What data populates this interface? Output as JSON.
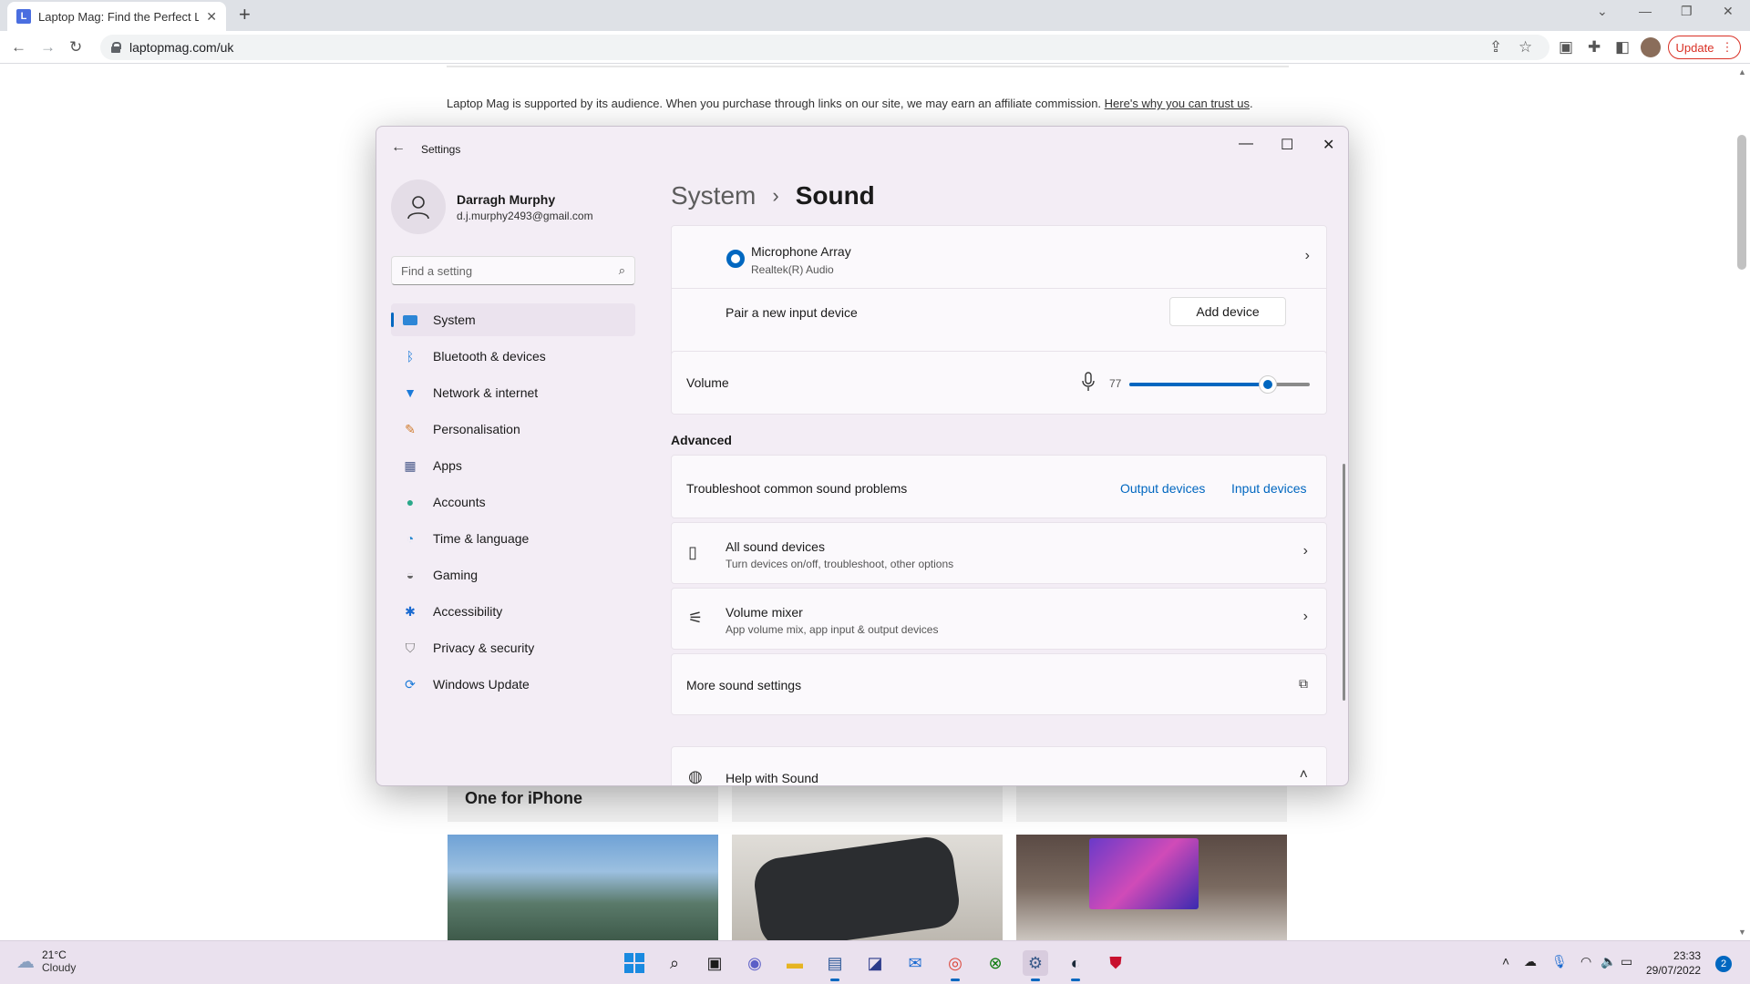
{
  "browser": {
    "tab_title": "Laptop Mag: Find the Perfect Lap",
    "url": "laptopmag.com/uk",
    "update_label": "Update"
  },
  "page": {
    "affiliate_text": "Laptop Mag is supported by its audience. When you purchase through links on our site, we may earn an affiliate commission.",
    "affiliate_link": "Here's why you can trust us",
    "card_title": "One for iPhone"
  },
  "settings": {
    "window_title": "Settings",
    "user": {
      "name": "Darragh Murphy",
      "email": "d.j.murphy2493@gmail.com"
    },
    "search_placeholder": "Find a setting",
    "nav": [
      {
        "label": "System",
        "icon": "monitor-icon",
        "active": true
      },
      {
        "label": "Bluetooth & devices",
        "icon": "bluetooth-icon"
      },
      {
        "label": "Network & internet",
        "icon": "wifi-icon"
      },
      {
        "label": "Personalisation",
        "icon": "brush-icon"
      },
      {
        "label": "Apps",
        "icon": "apps-icon"
      },
      {
        "label": "Accounts",
        "icon": "person-icon"
      },
      {
        "label": "Time & language",
        "icon": "globe-clock-icon"
      },
      {
        "label": "Gaming",
        "icon": "gamepad-icon"
      },
      {
        "label": "Accessibility",
        "icon": "accessibility-icon"
      },
      {
        "label": "Privacy & security",
        "icon": "shield-icon"
      },
      {
        "label": "Windows Update",
        "icon": "update-icon"
      }
    ],
    "breadcrumb": {
      "parent": "System",
      "separator": "›",
      "current": "Sound"
    },
    "input_device": {
      "name": "Microphone Array",
      "driver": "Realtek(R) Audio"
    },
    "pair_label": "Pair a new input device",
    "add_device_label": "Add device",
    "volume": {
      "label": "Volume",
      "value": 77,
      "display": "77"
    },
    "advanced_title": "Advanced",
    "troubleshoot": {
      "label": "Troubleshoot common sound problems",
      "output_link": "Output devices",
      "input_link": "Input devices"
    },
    "all_devices": {
      "title": "All sound devices",
      "subtitle": "Turn devices on/off, troubleshoot, other options"
    },
    "mixer": {
      "title": "Volume mixer",
      "subtitle": "App volume mix, app input & output devices"
    },
    "more_settings": "More sound settings",
    "help_title": "Help with Sound"
  },
  "taskbar": {
    "weather_temp": "21°C",
    "weather_desc": "Cloudy",
    "time": "23:33",
    "date": "29/07/2022",
    "notifications": "2"
  },
  "colors": {
    "accent": "#0067c0",
    "update_red": "#d93025"
  }
}
